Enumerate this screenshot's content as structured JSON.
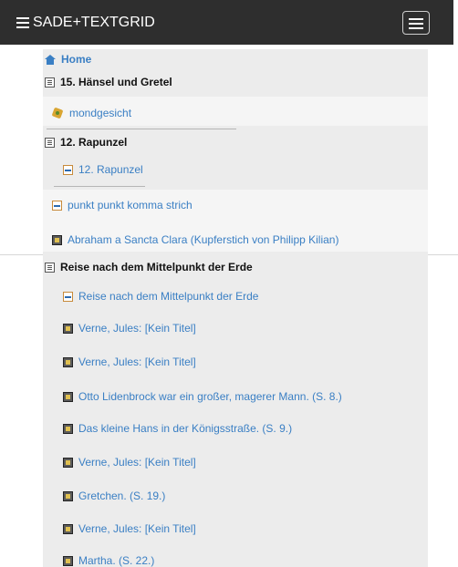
{
  "navbar": {
    "brand": "SADE+TEXTGRID",
    "brand_icon": "list-icon",
    "toggle_icon": "hamburger-icon"
  },
  "tree": {
    "home": "Home",
    "items": [
      {
        "label": "15. Hänsel und Gretel",
        "type": "folder",
        "icon": "book-icon"
      },
      {
        "label": "mondgesicht",
        "type": "item",
        "icon": "image-collection-icon"
      },
      {
        "label": "12. Rapunzel",
        "type": "folder",
        "icon": "book-icon"
      },
      {
        "label": "12. Rapunzel",
        "type": "item",
        "icon": "tei-icon"
      },
      {
        "label": "punkt punkt komma strich",
        "type": "item",
        "icon": "tei-icon"
      },
      {
        "label": "Abraham a Sancta Clara (Kupferstich von Philipp Kilian)",
        "type": "item",
        "icon": "image-icon"
      },
      {
        "label": "Reise nach dem Mittelpunkt der Erde",
        "type": "folder",
        "icon": "book-icon"
      },
      {
        "label": "Reise nach dem Mittelpunkt der Erde",
        "type": "item",
        "icon": "tei-icon"
      },
      {
        "label": "Verne, Jules: [Kein Titel]",
        "type": "item",
        "icon": "image-icon"
      },
      {
        "label": "Verne, Jules: [Kein Titel]",
        "type": "item",
        "icon": "image-icon"
      },
      {
        "label": "Otto Lidenbrock war ein großer, magerer Mann. (S. 8.)",
        "type": "item",
        "icon": "image-icon"
      },
      {
        "label": "Das kleine Hans in der Königsstraße. (S. 9.)",
        "type": "item",
        "icon": "image-icon"
      },
      {
        "label": "Verne, Jules: [Kein Titel]",
        "type": "item",
        "icon": "image-icon"
      },
      {
        "label": "Gretchen. (S. 19.)",
        "type": "item",
        "icon": "image-icon"
      },
      {
        "label": "Verne, Jules: [Kein Titel]",
        "type": "item",
        "icon": "image-icon"
      },
      {
        "label": "Martha. (S. 22.)",
        "type": "item",
        "icon": "image-icon"
      }
    ]
  }
}
